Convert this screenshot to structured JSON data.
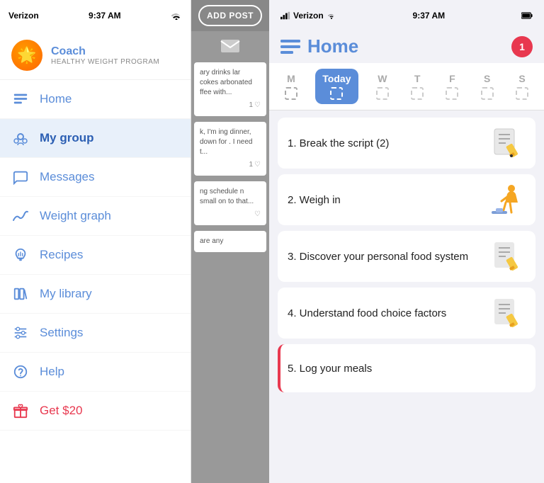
{
  "left_panel": {
    "status": {
      "carrier": "Verizon",
      "time": "9:37 AM",
      "wifi": true
    },
    "coach": {
      "name": "Coach",
      "subtitle": "HEALTHY WEIGHT PROGRAM"
    },
    "nav_items": [
      {
        "id": "home",
        "label": "Home",
        "icon": "home-icon",
        "active": false
      },
      {
        "id": "my-group",
        "label": "My group",
        "icon": "group-icon",
        "active": true
      },
      {
        "id": "messages",
        "label": "Messages",
        "icon": "messages-icon",
        "active": false
      },
      {
        "id": "weight-graph",
        "label": "Weight graph",
        "icon": "graph-icon",
        "active": false
      },
      {
        "id": "recipes",
        "label": "Recipes",
        "icon": "recipes-icon",
        "active": false
      },
      {
        "id": "my-library",
        "label": "My library",
        "icon": "library-icon",
        "active": false
      },
      {
        "id": "settings",
        "label": "Settings",
        "icon": "settings-icon",
        "active": false
      },
      {
        "id": "help",
        "label": "Help",
        "icon": "help-icon",
        "active": false
      },
      {
        "id": "get20",
        "label": "Get $20",
        "icon": "gift-icon",
        "active": false
      }
    ]
  },
  "middle_panel": {
    "add_post_label": "ADD POST",
    "feed_items": [
      {
        "text": "ary drinks lar cokes arbonated ffee with...",
        "likes": "1",
        "like_icon": "♡"
      },
      {
        "text": "k, I'm ing dinner, down for . I need t...",
        "likes": "1",
        "like_icon": "♡"
      },
      {
        "text": "ng schedule n small on to that...",
        "likes": "",
        "like_icon": "♡"
      },
      {
        "text": "are any",
        "likes": "",
        "like_icon": ""
      }
    ]
  },
  "right_panel": {
    "status": {
      "carrier": "Verizon",
      "time": "9:37 AM",
      "wifi": true
    },
    "header": {
      "title": "Home",
      "notification_count": "1"
    },
    "days": [
      {
        "label": "M",
        "active": false
      },
      {
        "label": "Today",
        "active": true
      },
      {
        "label": "W",
        "active": false
      },
      {
        "label": "T",
        "active": false
      },
      {
        "label": "F",
        "active": false
      },
      {
        "label": "S",
        "active": false
      },
      {
        "label": "S",
        "active": false
      }
    ],
    "tasks": [
      {
        "number": "1.",
        "title": "Break the script (2)",
        "emoji": "📋✏️",
        "type": "note"
      },
      {
        "number": "2.",
        "title": "Weigh in",
        "emoji": "🏋️",
        "type": "person"
      },
      {
        "number": "3.",
        "title": "Discover your personal food system",
        "emoji": "📋✏️",
        "type": "note"
      },
      {
        "number": "4.",
        "title": "Understand food choice factors",
        "emoji": "📋✏️",
        "type": "note"
      },
      {
        "number": "5.",
        "title": "Log your meals",
        "emoji": "",
        "type": "log"
      }
    ]
  }
}
